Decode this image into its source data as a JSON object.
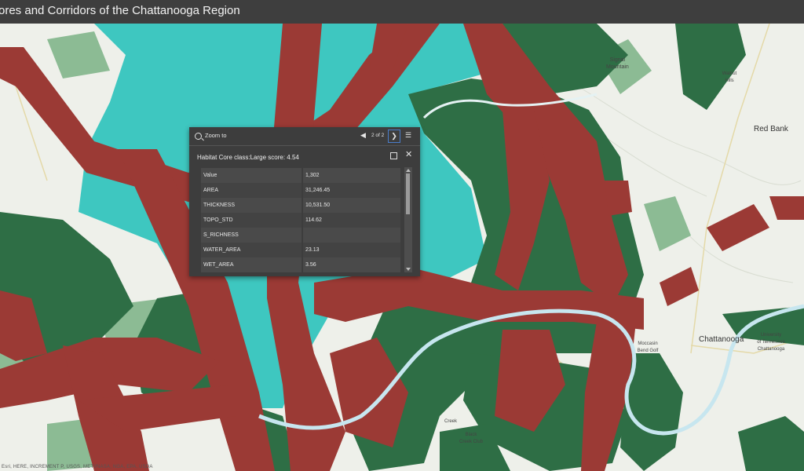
{
  "app": {
    "title": "ores and Corridors of the Chattanooga Region"
  },
  "map": {
    "colors": {
      "water_cyan": "#3ec7c0",
      "corridor_red": "#9b3a35",
      "forest_green": "#2e6e45",
      "light_green": "#7fae86",
      "basemap": "#eef0ea"
    },
    "labels": {
      "signal_mountain": "Signal\nMountain",
      "red_bank": "Red Bank",
      "chattanooga": "Chattanooga",
      "utc": "University\nof Tennessee\nChattanooga",
      "moccasin": "Moccasin\nBend Golf",
      "black_creek": "Black\nCreek Club",
      "creek": "Creek",
      "walnut": "Walnut\nHills"
    },
    "attribution": "Esri, HERE, INCREMENT P, USGS, METI/NASA, NGA, EPA, USDA"
  },
  "popup": {
    "zoom_label": "Zoom to",
    "counter": "2 of 2",
    "heading": "Habitat Core class:Large score: 4.54",
    "fields": [
      {
        "name": "Value",
        "value": "1,302"
      },
      {
        "name": "AREA",
        "value": "31,246.45"
      },
      {
        "name": "THICKNESS",
        "value": "10,531.50"
      },
      {
        "name": "TOPO_STD",
        "value": "114.62"
      },
      {
        "name": "S_RICHNESS",
        "value": ""
      },
      {
        "name": "WATER_AREA",
        "value": "23.13"
      },
      {
        "name": "WET_AREA",
        "value": "3.56"
      }
    ]
  }
}
